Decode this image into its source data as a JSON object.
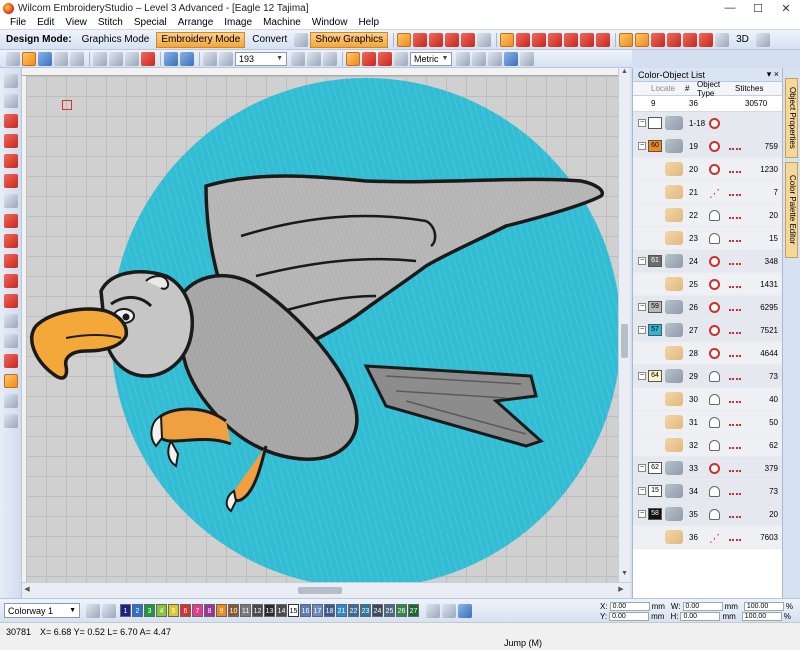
{
  "window": {
    "title": "Wilcom EmbroideryStudio – Level 3 Advanced - [Eagle 12        Tajima]",
    "minimize": "—",
    "maximize": "☐",
    "close": "✕"
  },
  "menu": [
    "File",
    "Edit",
    "View",
    "Stitch",
    "Special",
    "Arrange",
    "Image",
    "Machine",
    "Window",
    "Help"
  ],
  "toolbar1": {
    "design_mode_label": "Design Mode:",
    "graphics_mode": "Graphics Mode",
    "embroidery_mode": "Embroidery Mode",
    "convert": "Convert",
    "show_graphics": "Show Graphics",
    "view_3d": "3D"
  },
  "toolbar2": {
    "zoom_value": "193",
    "units": "Metric"
  },
  "panel": {
    "title": "Color-Object List",
    "pin": "▾ ×",
    "columns": {
      "locate": "Locate",
      "num": "#",
      "object_type": "Object Type",
      "stitches": "Stitches"
    },
    "summary": {
      "colors": "9",
      "objects": "36",
      "stitches": "30570"
    },
    "rows": [
      {
        "swatch": "",
        "num": "1-18",
        "stitches": "",
        "color": "#ffffff",
        "group": true,
        "type": "group"
      },
      {
        "swatch": "60",
        "num": "19",
        "stitches": "759",
        "color": "#f08a1a",
        "group": true,
        "type": "fill"
      },
      {
        "swatch": "",
        "num": "20",
        "stitches": "1230",
        "color": "",
        "group": false,
        "type": "fill"
      },
      {
        "swatch": "",
        "num": "21",
        "stitches": "7",
        "color": "",
        "group": false,
        "type": "line"
      },
      {
        "swatch": "",
        "num": "22",
        "stitches": "20",
        "color": "",
        "group": false,
        "type": "satin"
      },
      {
        "swatch": "",
        "num": "23",
        "stitches": "15",
        "color": "",
        "group": false,
        "type": "satin"
      },
      {
        "swatch": "61",
        "num": "24",
        "stitches": "348",
        "color": "#6e6e6e",
        "group": true,
        "type": "fill"
      },
      {
        "swatch": "",
        "num": "25",
        "stitches": "1431",
        "color": "",
        "group": false,
        "type": "fill"
      },
      {
        "swatch": "59",
        "num": "26",
        "stitches": "6295",
        "color": "#b8b8b8",
        "group": true,
        "type": "fill"
      },
      {
        "swatch": "57",
        "num": "27",
        "stitches": "7521",
        "color": "#2ab8d4",
        "group": true,
        "type": "fill"
      },
      {
        "swatch": "",
        "num": "28",
        "stitches": "4644",
        "color": "",
        "group": false,
        "type": "fill"
      },
      {
        "swatch": "64",
        "num": "29",
        "stitches": "73",
        "color": "#fff6c8",
        "group": true,
        "type": "satin"
      },
      {
        "swatch": "",
        "num": "30",
        "stitches": "40",
        "color": "",
        "group": false,
        "type": "satin"
      },
      {
        "swatch": "",
        "num": "31",
        "stitches": "50",
        "color": "",
        "group": false,
        "type": "satin"
      },
      {
        "swatch": "",
        "num": "32",
        "stitches": "62",
        "color": "",
        "group": false,
        "type": "satin"
      },
      {
        "swatch": "62",
        "num": "33",
        "stitches": "379",
        "color": "#ffffff",
        "group": true,
        "type": "fill"
      },
      {
        "swatch": "15",
        "num": "34",
        "stitches": "73",
        "color": "#ffffff",
        "group": true,
        "type": "satin"
      },
      {
        "swatch": "58",
        "num": "35",
        "stitches": "20",
        "color": "#111111",
        "group": true,
        "type": "satin"
      },
      {
        "swatch": "",
        "num": "36",
        "stitches": "7603",
        "color": "",
        "group": false,
        "type": "line"
      }
    ]
  },
  "side_tabs": [
    "Object Properties",
    "Color Palette Editor"
  ],
  "colorbar": {
    "colorway": "Colorway 1",
    "chips": [
      {
        "n": "1",
        "c": "#1a237e"
      },
      {
        "n": "2",
        "c": "#2a6fd4"
      },
      {
        "n": "3",
        "c": "#1a9a3a"
      },
      {
        "n": "4",
        "c": "#8ac43a"
      },
      {
        "n": "5",
        "c": "#d8c82a"
      },
      {
        "n": "6",
        "c": "#d8302a"
      },
      {
        "n": "7",
        "c": "#e83a8a"
      },
      {
        "n": "8",
        "c": "#a0309a"
      },
      {
        "n": "9",
        "c": "#f08a1a"
      },
      {
        "n": "10",
        "c": "#8a5a2a"
      },
      {
        "n": "11",
        "c": "#7a7a7a"
      },
      {
        "n": "12",
        "c": "#4a4a4a"
      },
      {
        "n": "13",
        "c": "#2a2a2a"
      },
      {
        "n": "14",
        "c": "#4a4a4a"
      },
      {
        "n": "15",
        "c": "#ffffff"
      },
      {
        "n": "16",
        "c": "#5a7ab8"
      },
      {
        "n": "17",
        "c": "#6a8ac8"
      },
      {
        "n": "18",
        "c": "#3a5a9a"
      },
      {
        "n": "21",
        "c": "#2a8ad4"
      },
      {
        "n": "22",
        "c": "#3a6a9a"
      },
      {
        "n": "23",
        "c": "#2a7aa0"
      },
      {
        "n": "24",
        "c": "#3a4a5a"
      },
      {
        "n": "25",
        "c": "#4a6a8a"
      },
      {
        "n": "26",
        "c": "#2a8a4a"
      },
      {
        "n": "27",
        "c": "#1a6a2a"
      }
    ],
    "x_label": "X:",
    "x_value": "0.00",
    "w_label": "W:",
    "w_value": "0.00",
    "w_pct": "100.00",
    "y_label": "Y:",
    "y_value": "0.00",
    "h_label": "H:",
    "h_value": "0.00",
    "h_pct": "100.00",
    "unit": "mm",
    "pct": "%"
  },
  "status": {
    "stitch_count": "30781",
    "coords": "X=  6.68 Y=  0.52 L=  6.70 A=  4.47",
    "mode": "Jump (M)"
  },
  "colors": {
    "accent": "#f5a53a",
    "background_circle": "#33bdd4",
    "wing_gray": "#b8b8b8",
    "beak": "#f5a83a"
  }
}
